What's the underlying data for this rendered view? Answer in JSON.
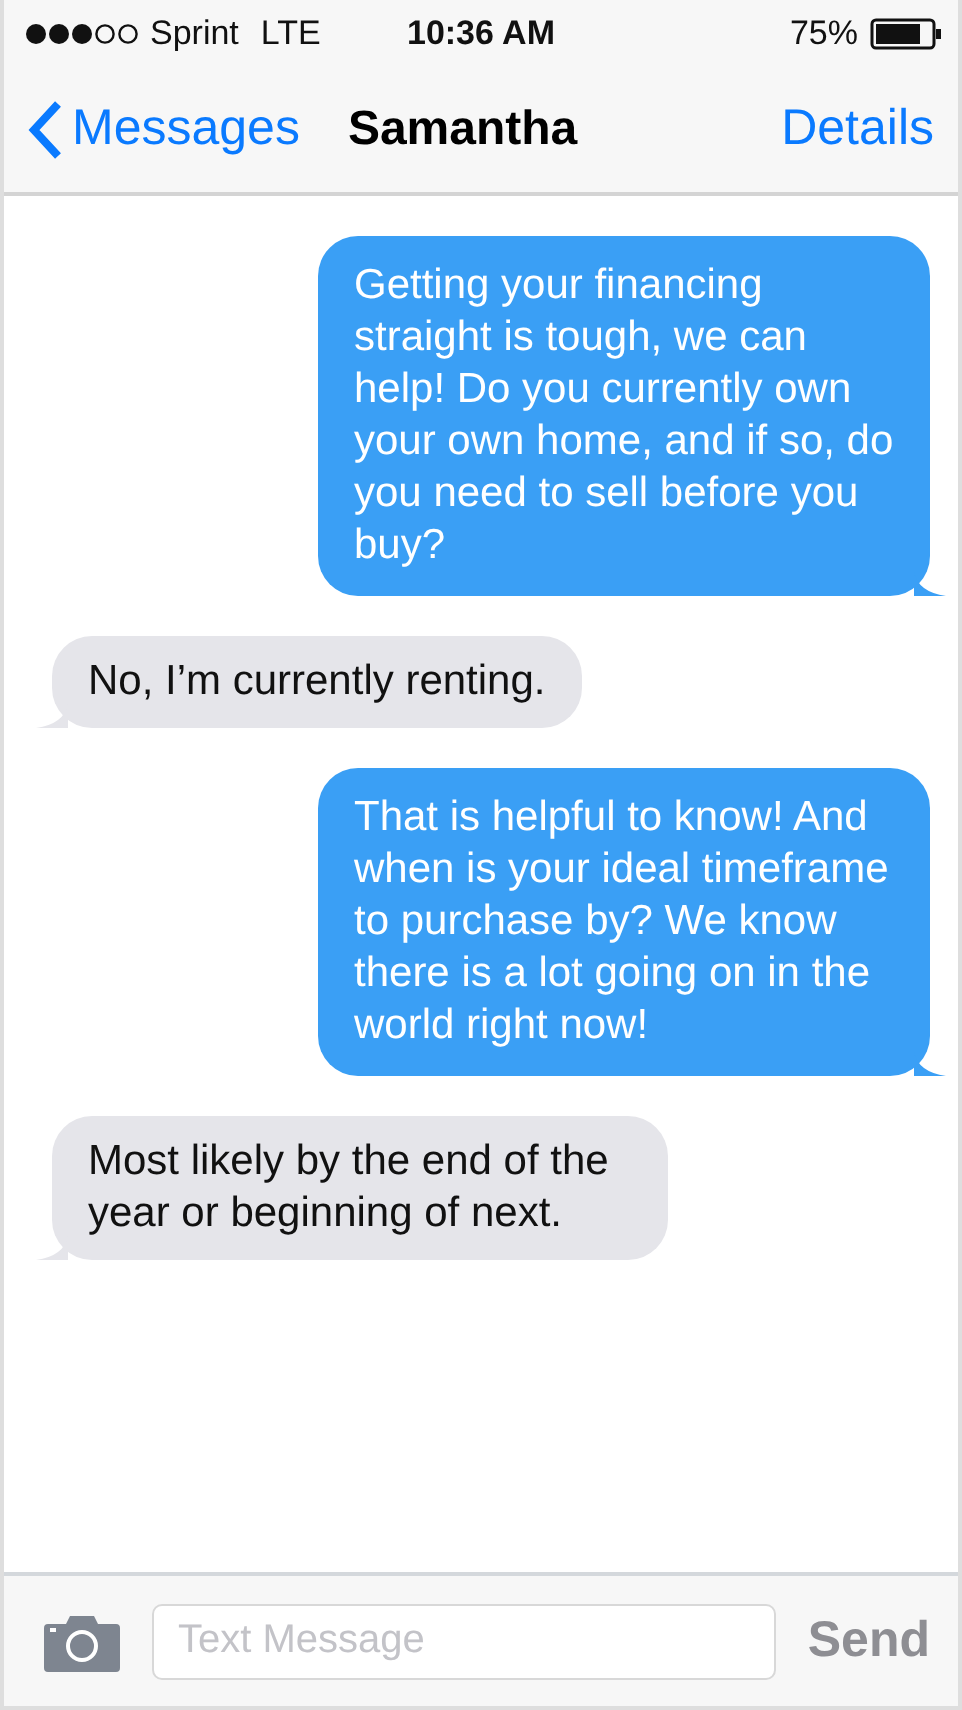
{
  "status_bar": {
    "carrier": "Sprint",
    "network": "LTE",
    "time": "10:36 AM",
    "battery": "75%"
  },
  "nav_bar": {
    "back": "Messages",
    "title": "Samantha",
    "action": "Details"
  },
  "messages": [
    {
      "kind": "sent",
      "text": "Getting your financing straight is tough, we can help! Do you currently own your own home, and if so, do you need to sell before you buy?"
    },
    {
      "kind": "received",
      "text": "No, I’m currently renting."
    },
    {
      "kind": "sent",
      "text": "That is helpful to know! And when is your ideal timeframe to purchase by? We know there is a lot going on in the world right now!"
    },
    {
      "kind": "received",
      "text": "Most likely by the end of the year or beginning of next."
    }
  ],
  "input_bar": {
    "placeholder": "Text Message",
    "send": "Send"
  }
}
